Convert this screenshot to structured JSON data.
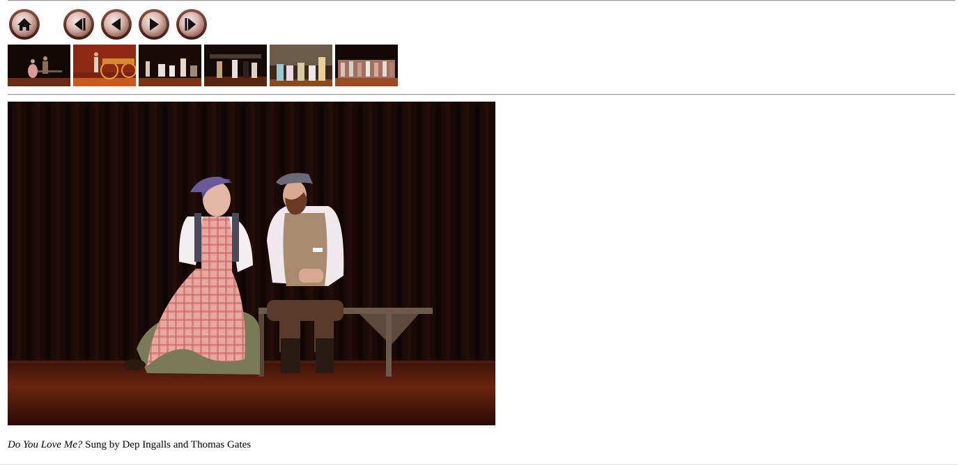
{
  "nav": {
    "home": {
      "icon": "home-icon"
    },
    "first": {
      "icon": "first-icon"
    },
    "previous": {
      "icon": "previous-icon"
    },
    "next": {
      "icon": "next-icon"
    },
    "last": {
      "icon": "last-icon"
    }
  },
  "thumbnails": [
    {
      "scene": "couple-on-bench"
    },
    {
      "scene": "orange-wagon"
    },
    {
      "scene": "group-in-room"
    },
    {
      "scene": "dancers"
    },
    {
      "scene": "women-group"
    },
    {
      "scene": "full-cast"
    }
  ],
  "caption": {
    "title": "Do You Love Me?",
    "text": " Sung by Dep Ingalls and Thomas Gates"
  },
  "colors": {
    "button_rim": "#6b3a2e",
    "button_face": "#d9b8b0",
    "curtain": "#1a0c08",
    "stage": "#5a1e10"
  }
}
